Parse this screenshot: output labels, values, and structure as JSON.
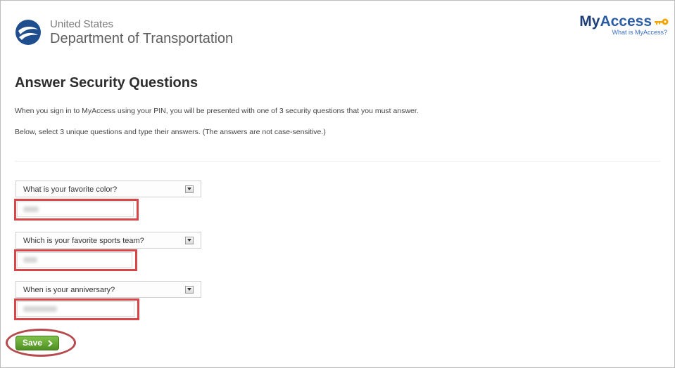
{
  "header": {
    "agency_line1": "United States",
    "agency_line2": "Department of Transportation",
    "brand_my": "My",
    "brand_access": "Access",
    "brand_link": "What is MyAccess?"
  },
  "main": {
    "title": "Answer Security Questions",
    "intro_1": "When you sign in to MyAccess using your PIN, you will be presented with one of 3 security questions that you must answer.",
    "intro_2": "Below, select 3 unique questions and type their answers. (The answers are not case-sensitive.)",
    "questions": [
      {
        "label": "What is your favorite color?"
      },
      {
        "label": "Which is your favorite sports team?"
      },
      {
        "label": "When is your anniversary?"
      }
    ],
    "save_label": "Save"
  },
  "colors": {
    "brand_blue": "#2a5da3",
    "highlight_red": "#d9464a",
    "save_green": "#5fa02f",
    "key_orange": "#f0a500"
  },
  "icons": {
    "logo": "dot-eagle-logo",
    "key": "key-icon",
    "dropdown": "chevron-down-icon",
    "save": "chevron-right-icon"
  }
}
